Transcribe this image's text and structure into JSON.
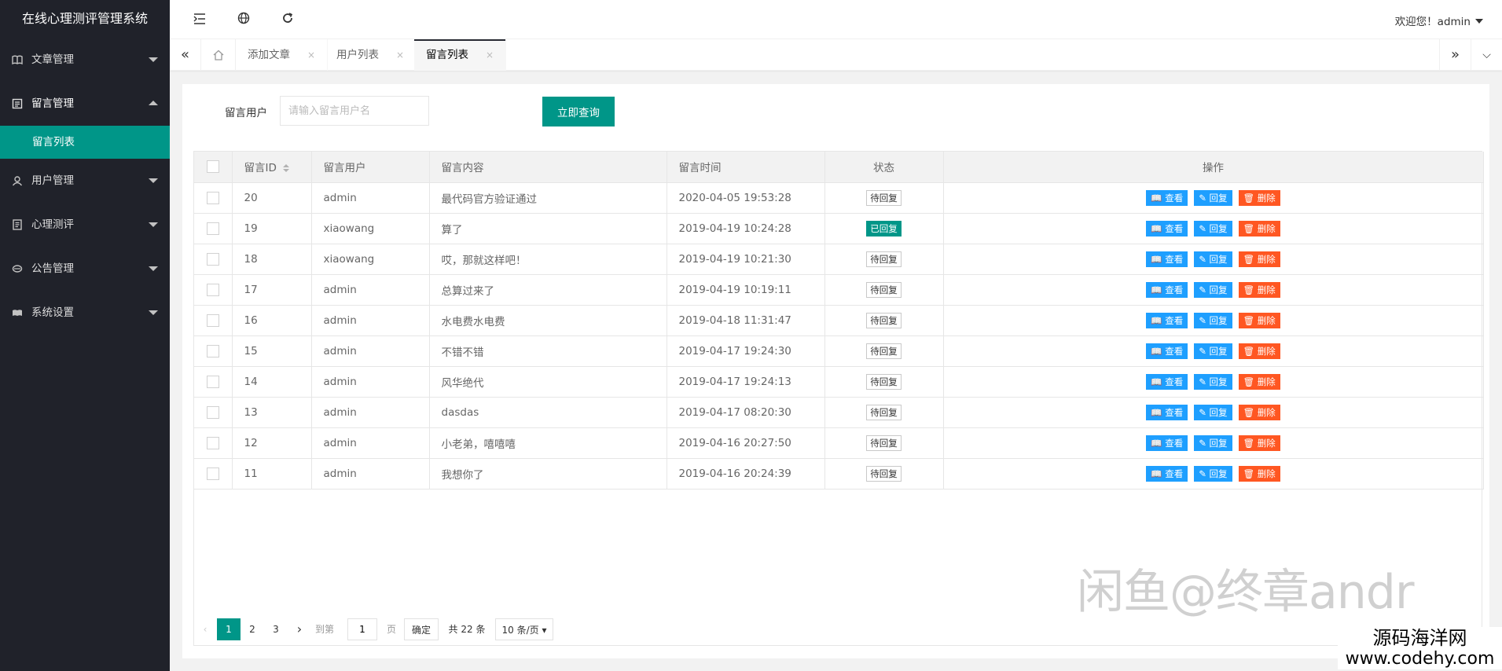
{
  "app": {
    "title": "在线心理测评管理系统"
  },
  "sidebar": {
    "items": [
      {
        "label": "文章管理",
        "icon": "book-icon"
      },
      {
        "label": "留言管理",
        "icon": "message-icon",
        "open": true,
        "sub": [
          {
            "label": "留言列表"
          }
        ]
      },
      {
        "label": "用户管理",
        "icon": "user-icon"
      },
      {
        "label": "心理测评",
        "icon": "document-icon"
      },
      {
        "label": "公告管理",
        "icon": "announce-icon"
      },
      {
        "label": "系统设置",
        "icon": "settings-icon"
      }
    ]
  },
  "header": {
    "user_greeting": "欢迎您！admin"
  },
  "tabs": [
    {
      "label": "添加文章"
    },
    {
      "label": "用户列表"
    },
    {
      "label": "留言列表",
      "active": true
    }
  ],
  "search": {
    "label": "留言用户",
    "placeholder": "请输入留言用户名",
    "button": "立即查询"
  },
  "table": {
    "headers": [
      "留言ID",
      "留言用户",
      "留言内容",
      "留言时间",
      "状态",
      "操作"
    ],
    "actions": {
      "view": "查看",
      "reply": "回复",
      "delete": "删除"
    },
    "rows": [
      {
        "id": "20",
        "user": "admin",
        "content": "最代码官方验证通过",
        "time": "2020-04-05 19:53:28",
        "status": "待回复",
        "replied": false
      },
      {
        "id": "19",
        "user": "xiaowang",
        "content": "算了",
        "time": "2019-04-19 10:24:28",
        "status": "已回复",
        "replied": true
      },
      {
        "id": "18",
        "user": "xiaowang",
        "content": "哎，那就这样吧！",
        "time": "2019-04-19 10:21:30",
        "status": "待回复",
        "replied": false
      },
      {
        "id": "17",
        "user": "admin",
        "content": "总算过来了",
        "time": "2019-04-19 10:19:11",
        "status": "待回复",
        "replied": false
      },
      {
        "id": "16",
        "user": "admin",
        "content": "水电费水电费",
        "time": "2019-04-18 11:31:47",
        "status": "待回复",
        "replied": false
      },
      {
        "id": "15",
        "user": "admin",
        "content": "不错不错",
        "time": "2019-04-17 19:24:30",
        "status": "待回复",
        "replied": false
      },
      {
        "id": "14",
        "user": "admin",
        "content": "风华绝代",
        "time": "2019-04-17 19:24:13",
        "status": "待回复",
        "replied": false
      },
      {
        "id": "13",
        "user": "admin",
        "content": "dasdas",
        "time": "2019-04-17 08:20:30",
        "status": "待回复",
        "replied": false
      },
      {
        "id": "12",
        "user": "admin",
        "content": "小老弟，嘻嘻嘻",
        "time": "2019-04-16 20:27:50",
        "status": "待回复",
        "replied": false
      },
      {
        "id": "11",
        "user": "admin",
        "content": "我想你了",
        "time": "2019-04-16 20:24:39",
        "status": "待回复",
        "replied": false
      }
    ]
  },
  "pager": {
    "pages": [
      "1",
      "2",
      "3"
    ],
    "current": "1",
    "goto_label": "到第",
    "goto_value": "1",
    "page_unit": "页",
    "confirm": "确定",
    "total": "共 22 条",
    "page_size": "10 条/页"
  },
  "watermark": "闲鱼@终章andr",
  "site_badge": {
    "line1": "源码海洋网",
    "line2": "www.codehy.com"
  },
  "colors": {
    "sidebar": "#20222a",
    "accent": "#009688",
    "blue": "#1e9fff",
    "orange": "#ff5722"
  }
}
